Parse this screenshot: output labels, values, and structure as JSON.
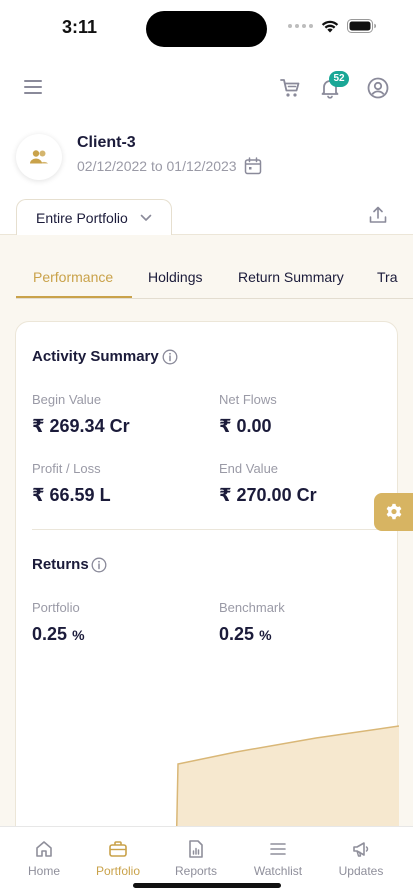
{
  "status_bar": {
    "time": "3:11"
  },
  "header": {
    "notification_count": "52"
  },
  "client": {
    "name": "Client-3",
    "date_range": "02/12/2022 to 01/12/2023"
  },
  "portfolio_selector": {
    "label": "Entire Portfolio"
  },
  "tabs": [
    {
      "label": "Performance"
    },
    {
      "label": "Holdings"
    },
    {
      "label": "Return Summary"
    },
    {
      "label": "Tra"
    }
  ],
  "activity_summary": {
    "title": "Activity Summary",
    "begin_value": {
      "label": "Begin Value",
      "value": "₹ 269.34 Cr"
    },
    "net_flows": {
      "label": "Net Flows",
      "value": "₹ 0.00"
    },
    "profit_loss": {
      "label": "Profit / Loss",
      "value": "₹ 66.59 L"
    },
    "end_value": {
      "label": "End Value",
      "value": "₹ 270.00 Cr"
    }
  },
  "returns": {
    "title": "Returns",
    "portfolio": {
      "label": "Portfolio",
      "value": "0.25",
      "unit": "%"
    },
    "benchmark": {
      "label": "Benchmark",
      "value": "0.25",
      "unit": "%"
    }
  },
  "area_chart": {
    "fill_color": "#f6e8cf",
    "line_color": "#d9b777"
  },
  "bottom_nav": [
    {
      "label": "Home"
    },
    {
      "label": "Portfolio"
    },
    {
      "label": "Reports"
    },
    {
      "label": "Watchlist"
    },
    {
      "label": "Updates"
    }
  ],
  "colors": {
    "accent": "#c9a24a",
    "badge": "#1aa796",
    "text": "#1b1b3a",
    "muted": "#9a9aa6"
  }
}
